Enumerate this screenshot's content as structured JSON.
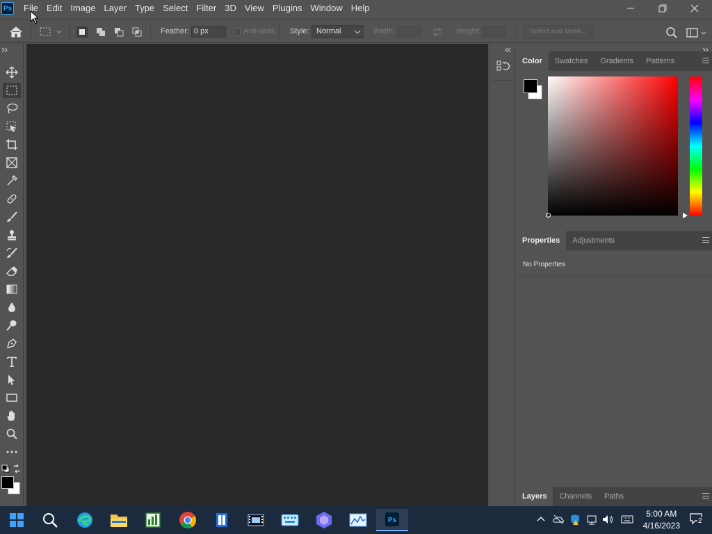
{
  "app": {
    "logo_text": "Ps"
  },
  "menu": [
    "File",
    "Edit",
    "Image",
    "Layer",
    "Type",
    "Select",
    "Filter",
    "3D",
    "View",
    "Plugins",
    "Window",
    "Help"
  ],
  "options": {
    "feather_label": "Feather:",
    "feather_value": "0 px",
    "antialias_label": "Anti-alias",
    "style_label": "Style:",
    "style_value": "Normal",
    "width_label": "Width:",
    "height_label": "Height:",
    "select_mask_label": "Select and Mask..."
  },
  "tools": [
    "move-tool",
    "rectangular-marquee-tool",
    "lasso-tool",
    "object-selection-tool",
    "crop-tool",
    "frame-tool",
    "eyedropper-tool",
    "spot-healing-tool",
    "brush-tool",
    "clone-stamp-tool",
    "history-brush-tool",
    "eraser-tool",
    "gradient-tool",
    "blur-tool",
    "dodge-tool",
    "pen-tool",
    "type-tool",
    "path-selection-tool",
    "rectangle-tool",
    "hand-tool",
    "zoom-tool",
    "edit-toolbar"
  ],
  "color_panel": {
    "tabs": [
      "Color",
      "Swatches",
      "Gradients",
      "Patterns"
    ],
    "active_tab": "Color",
    "hue_color": "#ff0000",
    "foreground": "#000000",
    "background": "#ffffff"
  },
  "properties_panel": {
    "tabs": [
      "Properties",
      "Adjustments"
    ],
    "active_tab": "Properties",
    "empty_text": "No Properties"
  },
  "layers_panel": {
    "tabs": [
      "Layers",
      "Channels",
      "Paths"
    ],
    "active_tab": "Layers"
  },
  "taskbar": {
    "apps": [
      "start",
      "search",
      "edge",
      "file-explorer",
      "spreadsheet-app",
      "chrome",
      "reader-app",
      "video-editor",
      "keyboard-app",
      "ai-app",
      "photo-app",
      "photoshop"
    ],
    "active_app": "photoshop",
    "clock_time": "5:00 AM",
    "clock_date": "4/16/2023",
    "notification_count": "2"
  }
}
